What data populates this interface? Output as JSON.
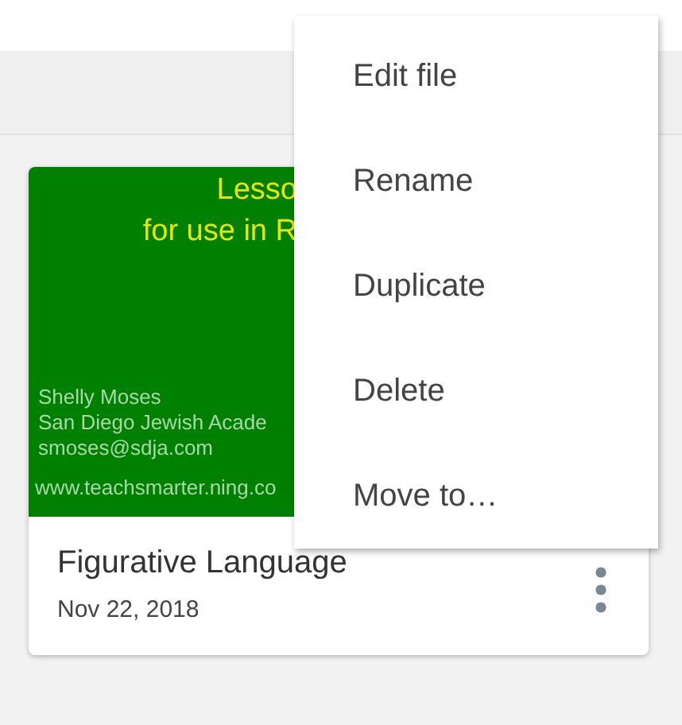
{
  "file_card": {
    "thumbnail": {
      "kind": "slide",
      "title_lines": [
        "Lesso",
        "for use in R"
      ],
      "author_lines": [
        "Shelly Moses",
        "San Diego Jewish Acade",
        "smoses@sdja.com"
      ],
      "url": "www.teachsmarter.ning.co"
    },
    "title": "Figurative Language",
    "date": "Nov 22, 2018"
  },
  "menu": {
    "items": [
      "Edit file",
      "Rename",
      "Duplicate",
      "Delete",
      "Move to…"
    ]
  }
}
